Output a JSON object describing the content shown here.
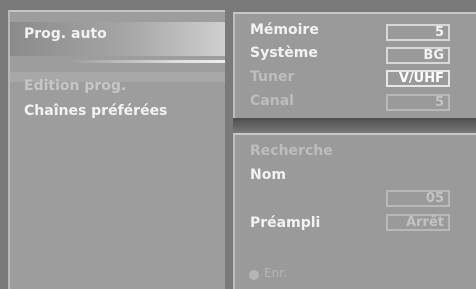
{
  "left_menu": {
    "items": [
      {
        "label": "Prog. auto"
      },
      {
        "label": "Edition prog."
      },
      {
        "label": "Chaînes préférées"
      }
    ]
  },
  "settings": {
    "memoire": {
      "label": "Mémoire",
      "value": "5"
    },
    "systeme": {
      "label": "Système",
      "value": "BG"
    },
    "tuner": {
      "label": "Tuner",
      "value": "V/UHF"
    },
    "canal": {
      "label": "Canal",
      "value": "5"
    }
  },
  "details": {
    "recherche_label": "Recherche",
    "nom_label": "Nom",
    "nom_value": "05",
    "preampli_label": "Préampli",
    "preampli_value": "Arrêt"
  },
  "footer": {
    "label": "Enr."
  }
}
